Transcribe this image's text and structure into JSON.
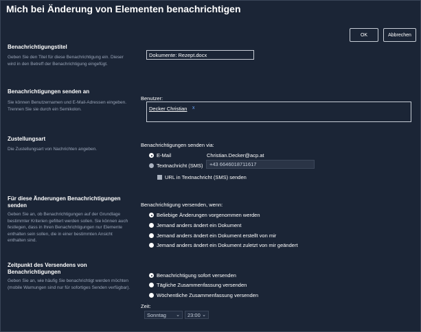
{
  "dialog": {
    "title": "Mich bei Änderung von Elementen benachrichtigen",
    "ok_label": "OK",
    "cancel_label": "Abbrechen"
  },
  "sections": {
    "title_section": {
      "heading": "Benachrichtigungstitel",
      "desc": "Geben Sie den Titel für diese Benachrichtigung ein. Dieser wird in den Betreff der Benachrichtigung eingefügt.",
      "value": "Dokumente: Rezept.docx"
    },
    "send_to": {
      "heading": "Benachrichtigungen senden an",
      "desc": "Sie können Benutzernamen und E-Mail-Adressen eingeben. Trennen Sie sie durch ein Semikolon.",
      "users_label": "Benutzer:",
      "user_token": "Decker Christian",
      "remove_symbol": "x"
    },
    "delivery": {
      "heading": "Zustellungsart",
      "desc": "Die Zustellungsart von Nachrichten angeben.",
      "via_label": "Benachrichtigungen senden via:",
      "email_label": "E-Mail",
      "email_value": "Christian.Decker@acp.at",
      "sms_label": "Textnachricht (SMS)",
      "sms_value": "+43 6646018711617",
      "url_sms_label": "URL in Textnachricht (SMS) senden"
    },
    "changes": {
      "heading_line1": "Für diese Änderungen Benachrichtigungen",
      "heading_line2": "senden",
      "desc": "Geben Sie an, ob Benachrichtigungen auf der Grundlage bestimmter Kriterien gefiltert werden sollen. Sie können auch festlegen, dass in Ihren Benachrichtigungen nur Elemente enthalten sein sollen, die in einer bestimmten Ansicht enthalten sind.",
      "when_label": "Benachrichtigung versenden, wenn:",
      "options": [
        "Beliebige Änderungen vorgenommen werden",
        "Jemand anders ändert ein Dokument",
        "Jemand anders ändert ein Dokument erstellt von mir",
        "Jemand anders ändert ein Dokument zuletzt von mir geändert"
      ]
    },
    "timing": {
      "heading_line1": "Zeitpunkt des Versendens von",
      "heading_line2": "Benachrichtigungen",
      "desc": "Geben Sie an, wie häufig Sie benachrichtigt werden möchten (mobile Warnungen sind nur für sofortiges Senden verfügbar).",
      "options": [
        "Benachrichtigung sofort versenden",
        "Tägliche Zusammenfassung versenden",
        "Wöchentliche Zusammenfassung versenden"
      ],
      "time_label": "Zeit:",
      "day_value": "Sonntag",
      "hour_value": "23:00"
    }
  }
}
